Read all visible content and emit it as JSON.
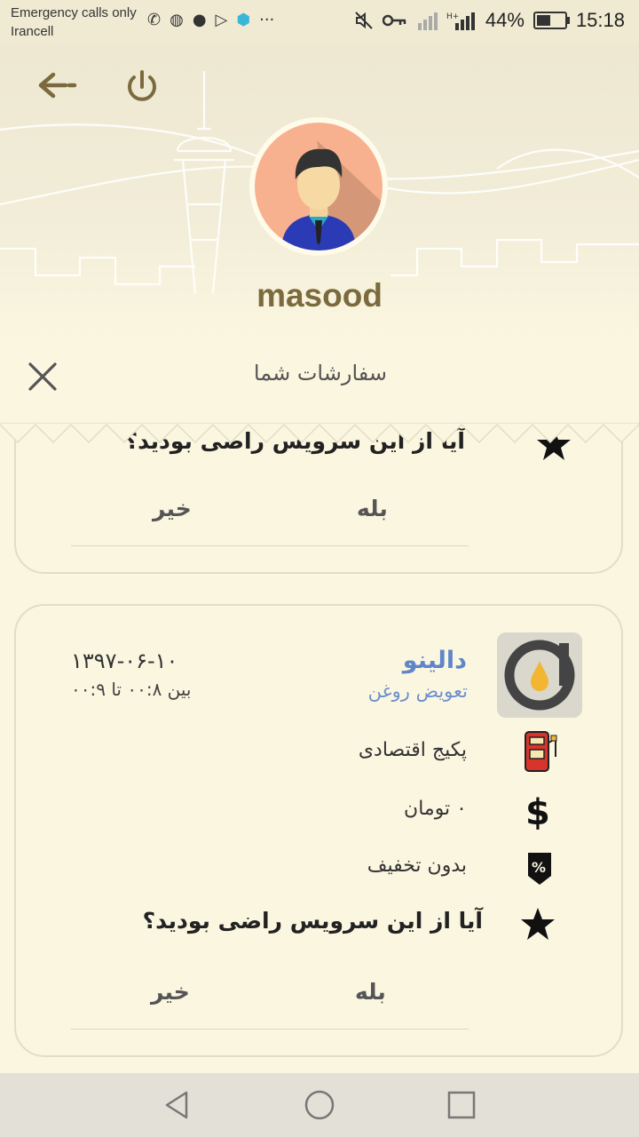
{
  "status_bar": {
    "carrier_line1": "Emergency calls only",
    "carrier_line2": "Irancell",
    "battery_percent": "44%",
    "battery_level": 0.44,
    "time": "15:18",
    "icons_left": [
      "missed-call-icon",
      "whatsapp-icon",
      "chat-icon",
      "play-store-icon",
      "vpn-key-icon",
      "more-icon"
    ],
    "icons_right": [
      "mute-icon",
      "key-icon",
      "no-signal-icon",
      "signal-icon"
    ]
  },
  "header": {
    "back_icon": "back-arrow-icon",
    "power_icon": "power-icon",
    "username": "masood",
    "brand_color": "#7B6A3D"
  },
  "orders": {
    "title": "سفارشات شما",
    "close_icon": "close-icon",
    "cards": [
      {
        "question": "آیا از این سرویس راضی بودید؟",
        "yes_label": "بله",
        "no_label": "خیر"
      },
      {
        "brand": "دالینو",
        "service": "تعویض روغن",
        "date": "۱۳۹۷-۰۶-۱۰",
        "time": "بین ۰۰:۸ تا ۰۰:۹",
        "package": "پکیج اقتصادی",
        "price": "۰ تومان",
        "discount": "بدون تخفیف",
        "question": "آیا از این سرویس راضی بودید؟",
        "yes_label": "بله",
        "no_label": "خیر",
        "accent_color": "#5F86C9"
      }
    ]
  },
  "nav": {
    "back": "nav-back-icon",
    "home": "nav-home-icon",
    "recents": "nav-recents-icon"
  }
}
